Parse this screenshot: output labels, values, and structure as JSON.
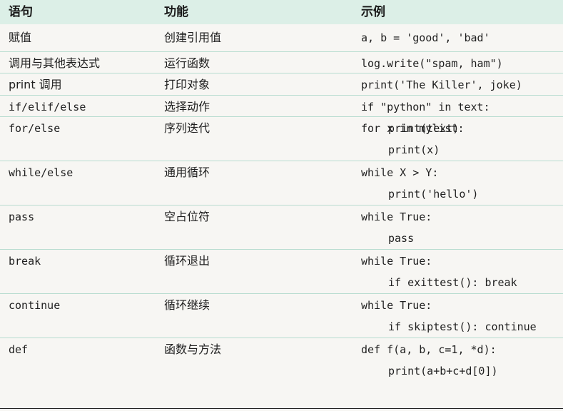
{
  "header": {
    "col_statement": "语句",
    "col_function": "功能",
    "col_example": "示例"
  },
  "rows": [
    {
      "statement": "赋值",
      "function": "创建引用值",
      "example": [
        "a, b = 'good', 'bad'"
      ]
    },
    {
      "statement": "调用与其他表达式",
      "function": "运行函数",
      "example": [
        "log.write(\"spam, ham\")"
      ]
    },
    {
      "statement": "print 调用",
      "function": "打印对象",
      "example": [
        "print('The Killer', joke)"
      ]
    },
    {
      "statement": "if/elif/else",
      "function": "选择动作",
      "example": [
        "if \"python\" in text:",
        "print(text)"
      ]
    },
    {
      "statement": "for/else",
      "function": "序列迭代",
      "example": [
        "for x in mylist:",
        "print(x)"
      ]
    },
    {
      "statement": "while/else",
      "function": "通用循环",
      "example": [
        "while X > Y:",
        "print('hello')"
      ]
    },
    {
      "statement": "pass",
      "function": "空占位符",
      "example": [
        "while True:",
        "pass"
      ]
    },
    {
      "statement": "break",
      "function": "循环退出",
      "example": [
        "while True:",
        "if exittest(): break"
      ]
    },
    {
      "statement": "continue",
      "function": "循环继续",
      "example": [
        "while True:",
        "if skiptest(): continue"
      ]
    },
    {
      "statement": "def",
      "function": "函数与方法",
      "example": [
        "def f(a, b, c=1, *d):",
        "print(a+b+c+d[0])"
      ]
    }
  ]
}
